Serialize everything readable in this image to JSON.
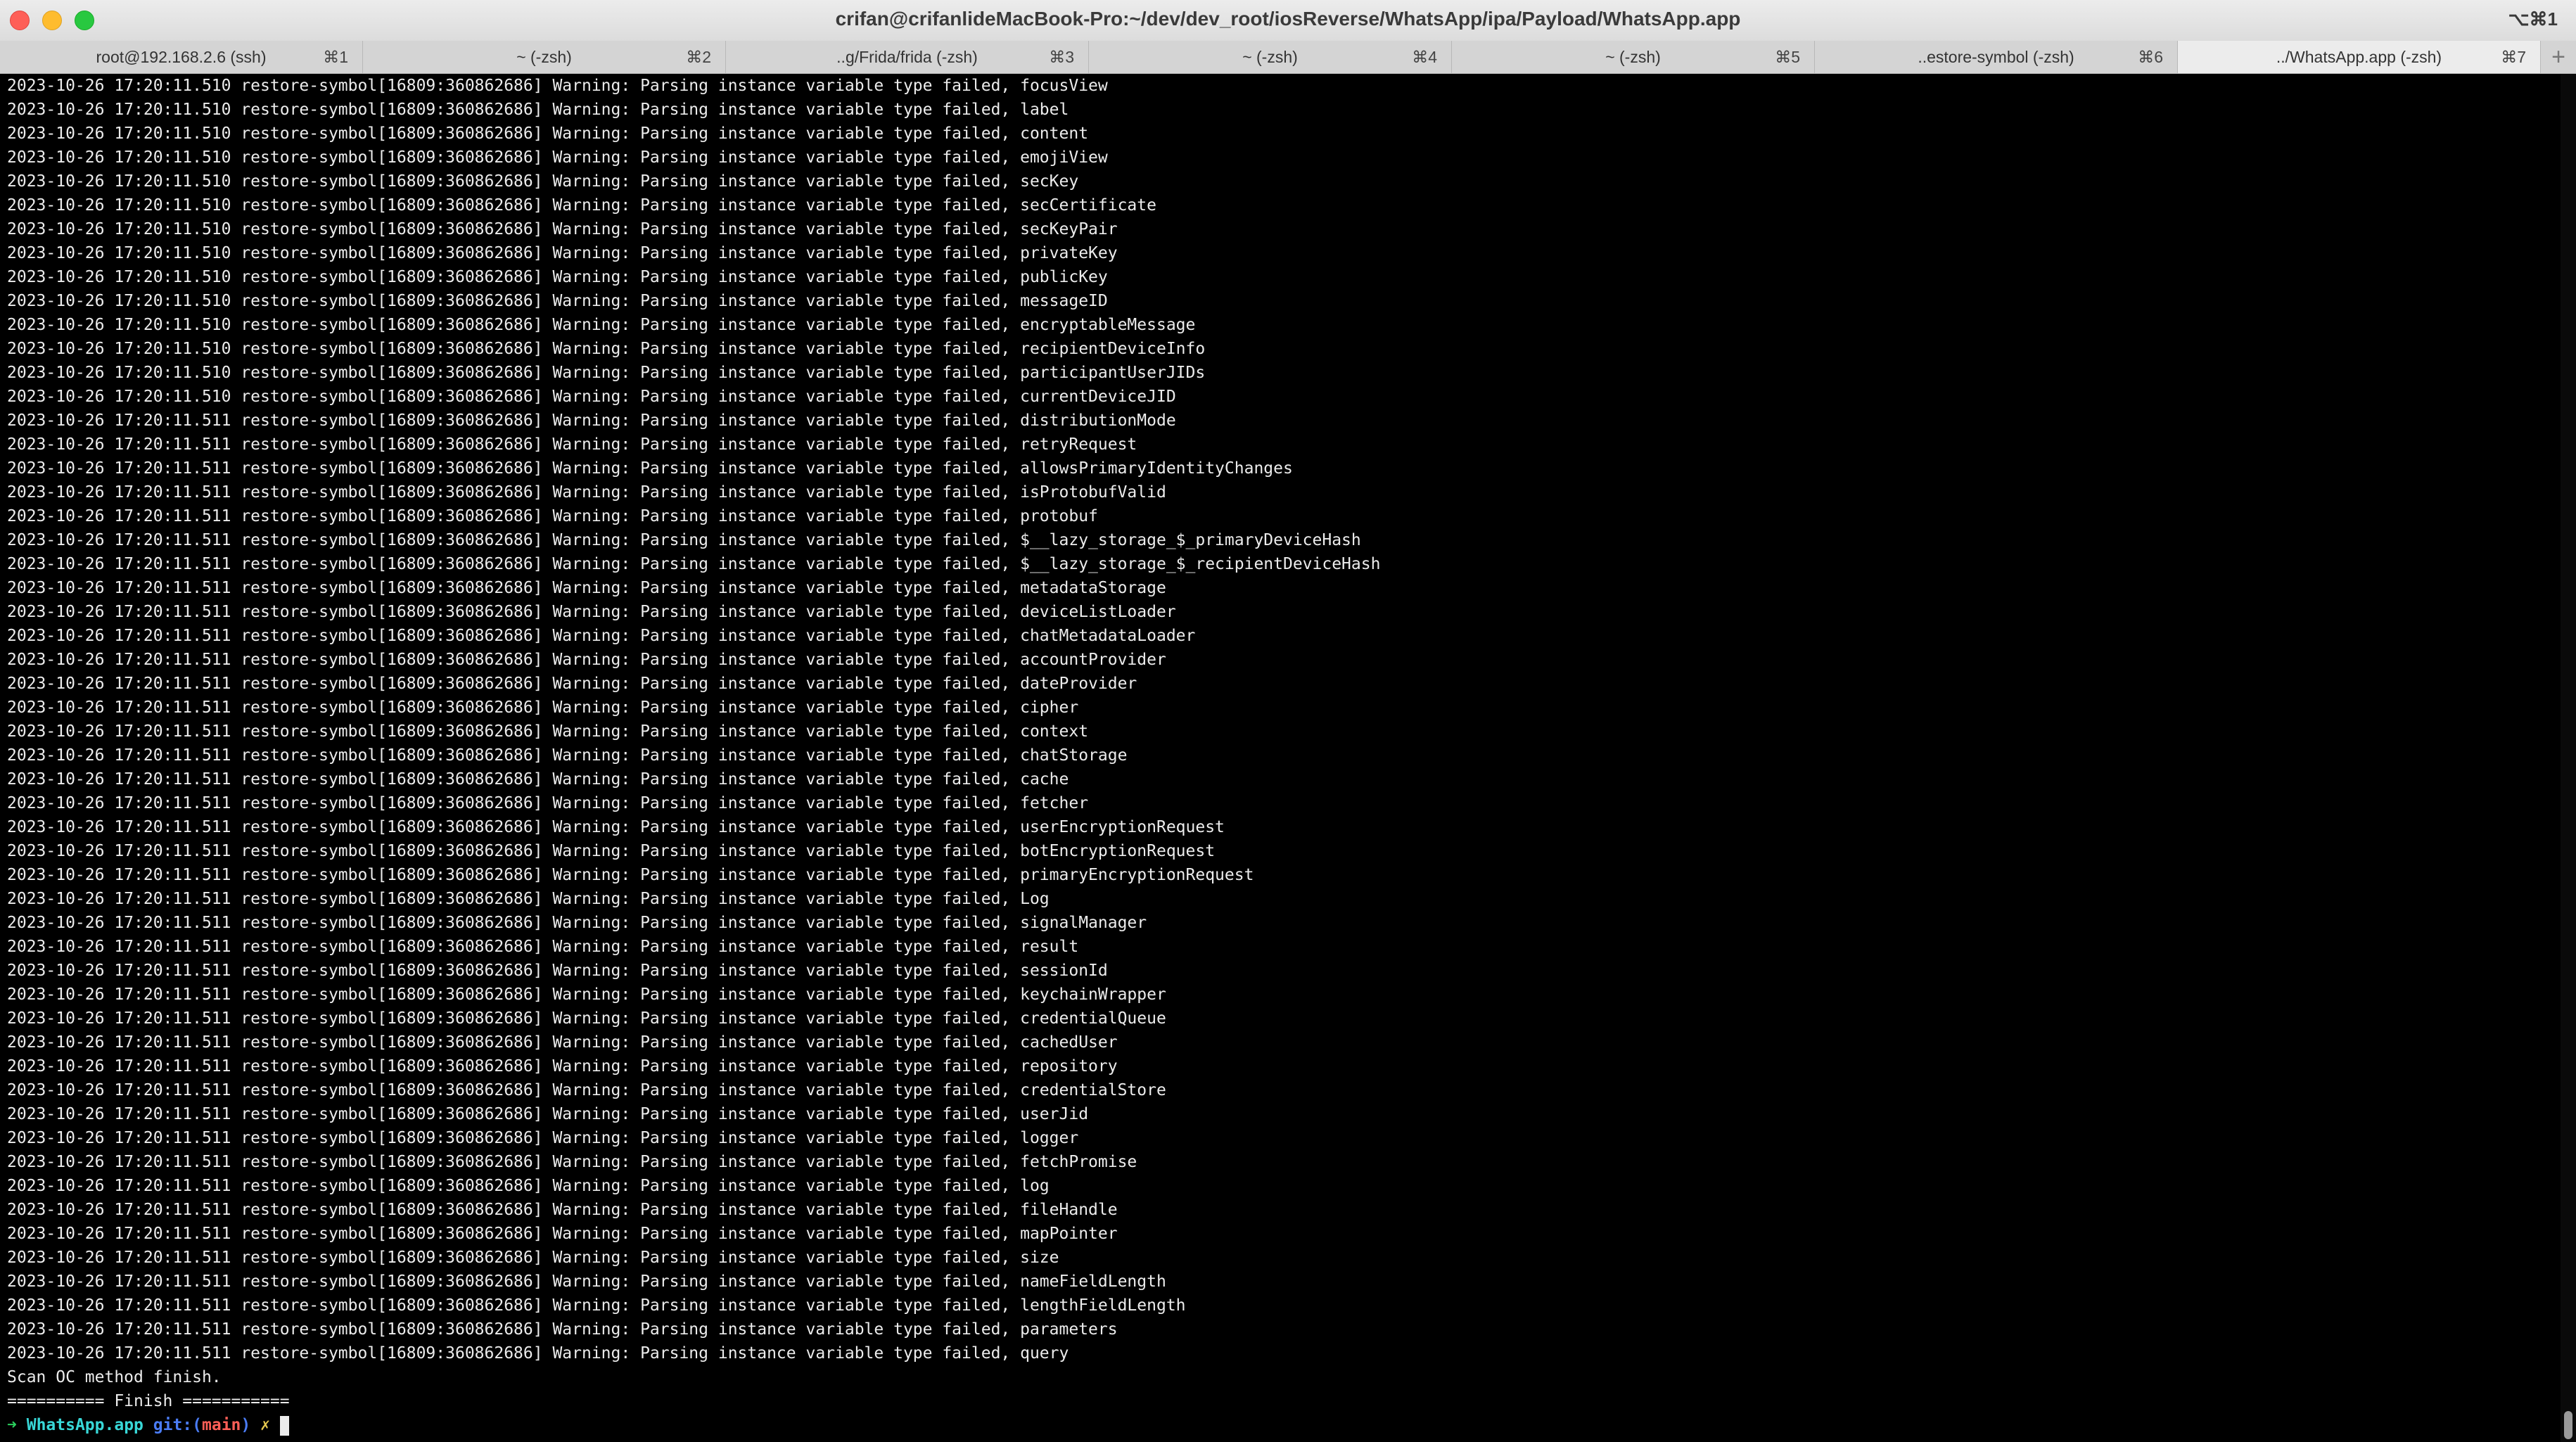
{
  "window": {
    "title": "crifan@crifanlideMacBook-Pro:~/dev/dev_root/iosReverse/WhatsApp/ipa/Payload/WhatsApp.app",
    "shortcut": "⌥⌘1"
  },
  "tabs": [
    {
      "label": "root@192.168.2.6 (ssh)",
      "shortcut": "⌘1"
    },
    {
      "label": "~ (-zsh)",
      "shortcut": "⌘2"
    },
    {
      "label": "..g/Frida/frida (-zsh)",
      "shortcut": "⌘3"
    },
    {
      "label": "~ (-zsh)",
      "shortcut": "⌘4"
    },
    {
      "label": "~ (-zsh)",
      "shortcut": "⌘5"
    },
    {
      "label": "..estore-symbol (-zsh)",
      "shortcut": "⌘6"
    },
    {
      "label": "../WhatsApp.app (-zsh)",
      "shortcut": "⌘7",
      "active": true
    }
  ],
  "new_tab_label": "+",
  "terminal": {
    "lines": [
      "2023-10-26 17:20:11.510 restore-symbol[16809:360862686] Warning: Parsing instance variable type failed, focusView",
      "2023-10-26 17:20:11.510 restore-symbol[16809:360862686] Warning: Parsing instance variable type failed, label",
      "2023-10-26 17:20:11.510 restore-symbol[16809:360862686] Warning: Parsing instance variable type failed, content",
      "2023-10-26 17:20:11.510 restore-symbol[16809:360862686] Warning: Parsing instance variable type failed, emojiView",
      "2023-10-26 17:20:11.510 restore-symbol[16809:360862686] Warning: Parsing instance variable type failed, secKey",
      "2023-10-26 17:20:11.510 restore-symbol[16809:360862686] Warning: Parsing instance variable type failed, secCertificate",
      "2023-10-26 17:20:11.510 restore-symbol[16809:360862686] Warning: Parsing instance variable type failed, secKeyPair",
      "2023-10-26 17:20:11.510 restore-symbol[16809:360862686] Warning: Parsing instance variable type failed, privateKey",
      "2023-10-26 17:20:11.510 restore-symbol[16809:360862686] Warning: Parsing instance variable type failed, publicKey",
      "2023-10-26 17:20:11.510 restore-symbol[16809:360862686] Warning: Parsing instance variable type failed, messageID",
      "2023-10-26 17:20:11.510 restore-symbol[16809:360862686] Warning: Parsing instance variable type failed, encryptableMessage",
      "2023-10-26 17:20:11.510 restore-symbol[16809:360862686] Warning: Parsing instance variable type failed, recipientDeviceInfo",
      "2023-10-26 17:20:11.510 restore-symbol[16809:360862686] Warning: Parsing instance variable type failed, participantUserJIDs",
      "2023-10-26 17:20:11.510 restore-symbol[16809:360862686] Warning: Parsing instance variable type failed, currentDeviceJID",
      "2023-10-26 17:20:11.511 restore-symbol[16809:360862686] Warning: Parsing instance variable type failed, distributionMode",
      "2023-10-26 17:20:11.511 restore-symbol[16809:360862686] Warning: Parsing instance variable type failed, retryRequest",
      "2023-10-26 17:20:11.511 restore-symbol[16809:360862686] Warning: Parsing instance variable type failed, allowsPrimaryIdentityChanges",
      "2023-10-26 17:20:11.511 restore-symbol[16809:360862686] Warning: Parsing instance variable type failed, isProtobufValid",
      "2023-10-26 17:20:11.511 restore-symbol[16809:360862686] Warning: Parsing instance variable type failed, protobuf",
      "2023-10-26 17:20:11.511 restore-symbol[16809:360862686] Warning: Parsing instance variable type failed, $__lazy_storage_$_primaryDeviceHash",
      "2023-10-26 17:20:11.511 restore-symbol[16809:360862686] Warning: Parsing instance variable type failed, $__lazy_storage_$_recipientDeviceHash",
      "2023-10-26 17:20:11.511 restore-symbol[16809:360862686] Warning: Parsing instance variable type failed, metadataStorage",
      "2023-10-26 17:20:11.511 restore-symbol[16809:360862686] Warning: Parsing instance variable type failed, deviceListLoader",
      "2023-10-26 17:20:11.511 restore-symbol[16809:360862686] Warning: Parsing instance variable type failed, chatMetadataLoader",
      "2023-10-26 17:20:11.511 restore-symbol[16809:360862686] Warning: Parsing instance variable type failed, accountProvider",
      "2023-10-26 17:20:11.511 restore-symbol[16809:360862686] Warning: Parsing instance variable type failed, dateProvider",
      "2023-10-26 17:20:11.511 restore-symbol[16809:360862686] Warning: Parsing instance variable type failed, cipher",
      "2023-10-26 17:20:11.511 restore-symbol[16809:360862686] Warning: Parsing instance variable type failed, context",
      "2023-10-26 17:20:11.511 restore-symbol[16809:360862686] Warning: Parsing instance variable type failed, chatStorage",
      "2023-10-26 17:20:11.511 restore-symbol[16809:360862686] Warning: Parsing instance variable type failed, cache",
      "2023-10-26 17:20:11.511 restore-symbol[16809:360862686] Warning: Parsing instance variable type failed, fetcher",
      "2023-10-26 17:20:11.511 restore-symbol[16809:360862686] Warning: Parsing instance variable type failed, userEncryptionRequest",
      "2023-10-26 17:20:11.511 restore-symbol[16809:360862686] Warning: Parsing instance variable type failed, botEncryptionRequest",
      "2023-10-26 17:20:11.511 restore-symbol[16809:360862686] Warning: Parsing instance variable type failed, primaryEncryptionRequest",
      "2023-10-26 17:20:11.511 restore-symbol[16809:360862686] Warning: Parsing instance variable type failed, Log",
      "2023-10-26 17:20:11.511 restore-symbol[16809:360862686] Warning: Parsing instance variable type failed, signalManager",
      "2023-10-26 17:20:11.511 restore-symbol[16809:360862686] Warning: Parsing instance variable type failed, result",
      "2023-10-26 17:20:11.511 restore-symbol[16809:360862686] Warning: Parsing instance variable type failed, sessionId",
      "2023-10-26 17:20:11.511 restore-symbol[16809:360862686] Warning: Parsing instance variable type failed, keychainWrapper",
      "2023-10-26 17:20:11.511 restore-symbol[16809:360862686] Warning: Parsing instance variable type failed, credentialQueue",
      "2023-10-26 17:20:11.511 restore-symbol[16809:360862686] Warning: Parsing instance variable type failed, cachedUser",
      "2023-10-26 17:20:11.511 restore-symbol[16809:360862686] Warning: Parsing instance variable type failed, repository",
      "2023-10-26 17:20:11.511 restore-symbol[16809:360862686] Warning: Parsing instance variable type failed, credentialStore",
      "2023-10-26 17:20:11.511 restore-symbol[16809:360862686] Warning: Parsing instance variable type failed, userJid",
      "2023-10-26 17:20:11.511 restore-symbol[16809:360862686] Warning: Parsing instance variable type failed, logger",
      "2023-10-26 17:20:11.511 restore-symbol[16809:360862686] Warning: Parsing instance variable type failed, fetchPromise",
      "2023-10-26 17:20:11.511 restore-symbol[16809:360862686] Warning: Parsing instance variable type failed, log",
      "2023-10-26 17:20:11.511 restore-symbol[16809:360862686] Warning: Parsing instance variable type failed, fileHandle",
      "2023-10-26 17:20:11.511 restore-symbol[16809:360862686] Warning: Parsing instance variable type failed, mapPointer",
      "2023-10-26 17:20:11.511 restore-symbol[16809:360862686] Warning: Parsing instance variable type failed, size",
      "2023-10-26 17:20:11.511 restore-symbol[16809:360862686] Warning: Parsing instance variable type failed, nameFieldLength",
      "2023-10-26 17:20:11.511 restore-symbol[16809:360862686] Warning: Parsing instance variable type failed, lengthFieldLength",
      "2023-10-26 17:20:11.511 restore-symbol[16809:360862686] Warning: Parsing instance variable type failed, parameters",
      "2023-10-26 17:20:11.511 restore-symbol[16809:360862686] Warning: Parsing instance variable type failed, query",
      "Scan OC method finish.",
      "========== Finish ==========="
    ],
    "prompt": {
      "arrow": "➜",
      "directory": "WhatsApp.app",
      "git_prefix": "git:(",
      "branch": "main",
      "git_suffix": ")",
      "dirty_mark": "✗"
    }
  },
  "colors": {
    "background": "#000000",
    "text": "#ececec",
    "prompt_arrow": "#2bd05d",
    "prompt_dir": "#38d8d8",
    "prompt_git": "#4a7cf5",
    "prompt_branch": "#ff5f57",
    "prompt_dirty": "#e6c84f"
  }
}
